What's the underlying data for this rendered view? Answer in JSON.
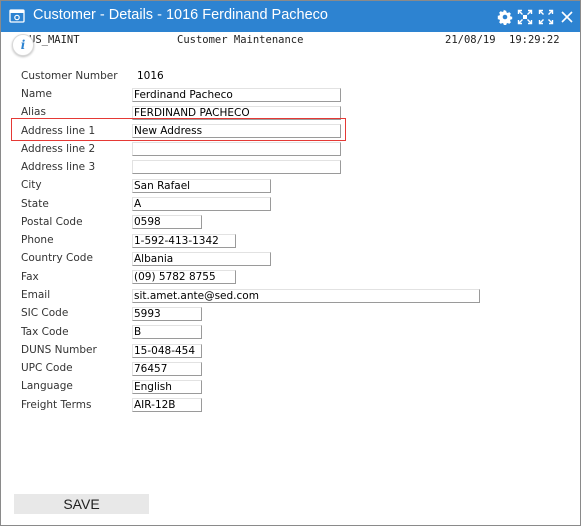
{
  "window": {
    "title": "Customer - Details - 1016 Ferdinand Pacheco"
  },
  "header": {
    "program": "US_MAINT",
    "screen_title": "Customer Maintenance",
    "date": "21/08/19",
    "time": "19:29:22"
  },
  "info_label": "i",
  "form": {
    "customer_number": {
      "label": "Customer Number",
      "value": "1016"
    },
    "name": {
      "label": "Name",
      "value": "Ferdinand Pacheco"
    },
    "alias": {
      "label": "Alias",
      "value": "FERDINAND PACHECO"
    },
    "address1": {
      "label": "Address line 1",
      "value": "New Address"
    },
    "address2": {
      "label": "Address line 2",
      "value": ""
    },
    "address3": {
      "label": "Address line 3",
      "value": ""
    },
    "city": {
      "label": "City",
      "value": "San Rafael"
    },
    "state": {
      "label": "State",
      "value": "A"
    },
    "postal_code": {
      "label": "Postal Code",
      "value": "0598"
    },
    "phone": {
      "label": "Phone",
      "value": "1-592-413-1342"
    },
    "country_code": {
      "label": "Country Code",
      "value": "Albania"
    },
    "fax": {
      "label": "Fax",
      "value": "(09) 5782 8755"
    },
    "email": {
      "label": "Email",
      "value": "sit.amet.ante@sed.com"
    },
    "sic_code": {
      "label": "SIC Code",
      "value": "5993"
    },
    "tax_code": {
      "label": "Tax Code",
      "value": "B"
    },
    "duns_number": {
      "label": "DUNS Number",
      "value": "15-048-454"
    },
    "upc_code": {
      "label": "UPC Code",
      "value": "76457"
    },
    "language": {
      "label": "Language",
      "value": "English"
    },
    "freight_terms": {
      "label": "Freight Terms",
      "value": "AIR-12B"
    }
  },
  "buttons": {
    "save": "SAVE"
  },
  "icons": {
    "app": "app-icon",
    "settings": "gear-icon",
    "restore": "restore-icon",
    "maximize": "maximize-icon"
  },
  "colors": {
    "titlebar": "#2d83d1",
    "highlight": "#e53935"
  }
}
